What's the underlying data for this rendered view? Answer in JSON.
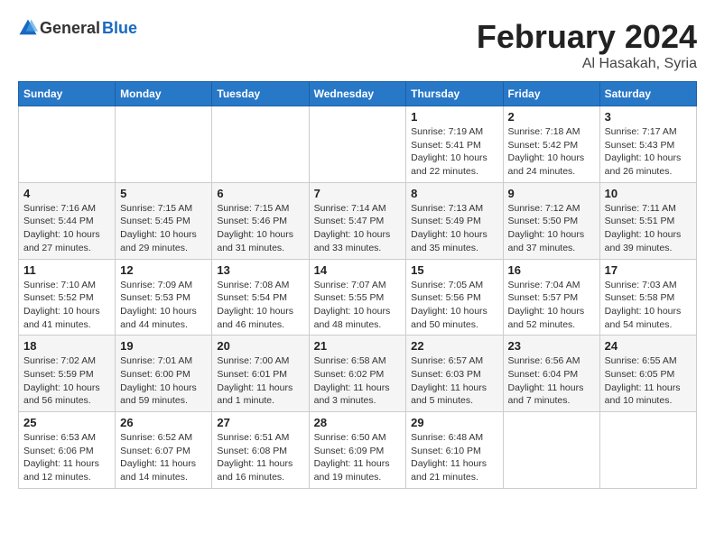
{
  "logo": {
    "text_general": "General",
    "text_blue": "Blue"
  },
  "title": {
    "month_year": "February 2024",
    "location": "Al Hasakah, Syria"
  },
  "weekdays": [
    "Sunday",
    "Monday",
    "Tuesday",
    "Wednesday",
    "Thursday",
    "Friday",
    "Saturday"
  ],
  "weeks": [
    [
      {
        "day": "",
        "info": ""
      },
      {
        "day": "",
        "info": ""
      },
      {
        "day": "",
        "info": ""
      },
      {
        "day": "",
        "info": ""
      },
      {
        "day": "1",
        "info": "Sunrise: 7:19 AM\nSunset: 5:41 PM\nDaylight: 10 hours\nand 22 minutes."
      },
      {
        "day": "2",
        "info": "Sunrise: 7:18 AM\nSunset: 5:42 PM\nDaylight: 10 hours\nand 24 minutes."
      },
      {
        "day": "3",
        "info": "Sunrise: 7:17 AM\nSunset: 5:43 PM\nDaylight: 10 hours\nand 26 minutes."
      }
    ],
    [
      {
        "day": "4",
        "info": "Sunrise: 7:16 AM\nSunset: 5:44 PM\nDaylight: 10 hours\nand 27 minutes."
      },
      {
        "day": "5",
        "info": "Sunrise: 7:15 AM\nSunset: 5:45 PM\nDaylight: 10 hours\nand 29 minutes."
      },
      {
        "day": "6",
        "info": "Sunrise: 7:15 AM\nSunset: 5:46 PM\nDaylight: 10 hours\nand 31 minutes."
      },
      {
        "day": "7",
        "info": "Sunrise: 7:14 AM\nSunset: 5:47 PM\nDaylight: 10 hours\nand 33 minutes."
      },
      {
        "day": "8",
        "info": "Sunrise: 7:13 AM\nSunset: 5:49 PM\nDaylight: 10 hours\nand 35 minutes."
      },
      {
        "day": "9",
        "info": "Sunrise: 7:12 AM\nSunset: 5:50 PM\nDaylight: 10 hours\nand 37 minutes."
      },
      {
        "day": "10",
        "info": "Sunrise: 7:11 AM\nSunset: 5:51 PM\nDaylight: 10 hours\nand 39 minutes."
      }
    ],
    [
      {
        "day": "11",
        "info": "Sunrise: 7:10 AM\nSunset: 5:52 PM\nDaylight: 10 hours\nand 41 minutes."
      },
      {
        "day": "12",
        "info": "Sunrise: 7:09 AM\nSunset: 5:53 PM\nDaylight: 10 hours\nand 44 minutes."
      },
      {
        "day": "13",
        "info": "Sunrise: 7:08 AM\nSunset: 5:54 PM\nDaylight: 10 hours\nand 46 minutes."
      },
      {
        "day": "14",
        "info": "Sunrise: 7:07 AM\nSunset: 5:55 PM\nDaylight: 10 hours\nand 48 minutes."
      },
      {
        "day": "15",
        "info": "Sunrise: 7:05 AM\nSunset: 5:56 PM\nDaylight: 10 hours\nand 50 minutes."
      },
      {
        "day": "16",
        "info": "Sunrise: 7:04 AM\nSunset: 5:57 PM\nDaylight: 10 hours\nand 52 minutes."
      },
      {
        "day": "17",
        "info": "Sunrise: 7:03 AM\nSunset: 5:58 PM\nDaylight: 10 hours\nand 54 minutes."
      }
    ],
    [
      {
        "day": "18",
        "info": "Sunrise: 7:02 AM\nSunset: 5:59 PM\nDaylight: 10 hours\nand 56 minutes."
      },
      {
        "day": "19",
        "info": "Sunrise: 7:01 AM\nSunset: 6:00 PM\nDaylight: 10 hours\nand 59 minutes."
      },
      {
        "day": "20",
        "info": "Sunrise: 7:00 AM\nSunset: 6:01 PM\nDaylight: 11 hours\nand 1 minute."
      },
      {
        "day": "21",
        "info": "Sunrise: 6:58 AM\nSunset: 6:02 PM\nDaylight: 11 hours\nand 3 minutes."
      },
      {
        "day": "22",
        "info": "Sunrise: 6:57 AM\nSunset: 6:03 PM\nDaylight: 11 hours\nand 5 minutes."
      },
      {
        "day": "23",
        "info": "Sunrise: 6:56 AM\nSunset: 6:04 PM\nDaylight: 11 hours\nand 7 minutes."
      },
      {
        "day": "24",
        "info": "Sunrise: 6:55 AM\nSunset: 6:05 PM\nDaylight: 11 hours\nand 10 minutes."
      }
    ],
    [
      {
        "day": "25",
        "info": "Sunrise: 6:53 AM\nSunset: 6:06 PM\nDaylight: 11 hours\nand 12 minutes."
      },
      {
        "day": "26",
        "info": "Sunrise: 6:52 AM\nSunset: 6:07 PM\nDaylight: 11 hours\nand 14 minutes."
      },
      {
        "day": "27",
        "info": "Sunrise: 6:51 AM\nSunset: 6:08 PM\nDaylight: 11 hours\nand 16 minutes."
      },
      {
        "day": "28",
        "info": "Sunrise: 6:50 AM\nSunset: 6:09 PM\nDaylight: 11 hours\nand 19 minutes."
      },
      {
        "day": "29",
        "info": "Sunrise: 6:48 AM\nSunset: 6:10 PM\nDaylight: 11 hours\nand 21 minutes."
      },
      {
        "day": "",
        "info": ""
      },
      {
        "day": "",
        "info": ""
      }
    ]
  ]
}
